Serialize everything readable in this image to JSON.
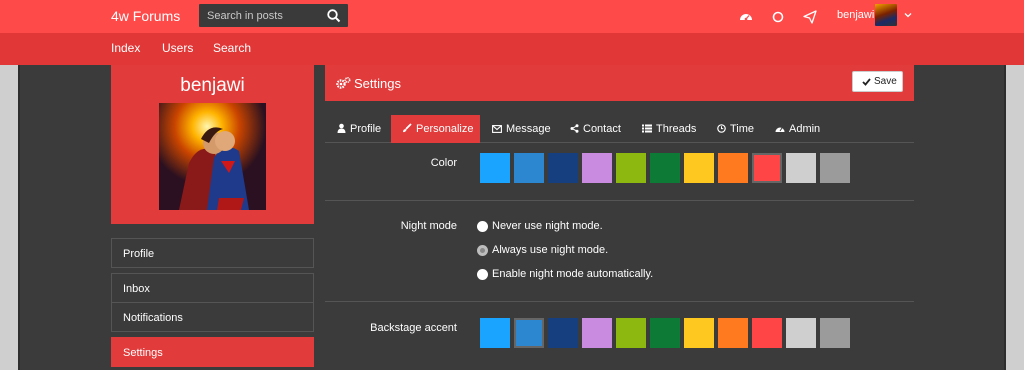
{
  "header": {
    "brand": "4w Forums",
    "search_placeholder": "Search in posts",
    "username": "benjawi"
  },
  "nav": {
    "items": [
      "Index",
      "Users",
      "Search"
    ]
  },
  "profile": {
    "name": "benjawi"
  },
  "sidebar": {
    "items": [
      "Profile",
      "Inbox",
      "Notifications",
      "Settings"
    ],
    "active": "Settings"
  },
  "settings": {
    "title": "Settings",
    "save_label": "Save",
    "tabs": [
      "Profile",
      "Personalize",
      "Message",
      "Contact",
      "Threads",
      "Time",
      "Admin"
    ],
    "active_tab": "Personalize",
    "color_label": "Color",
    "night_mode_label": "Night mode",
    "night_mode_options": [
      "Never use night mode.",
      "Always use night mode.",
      "Enable night mode automatically."
    ],
    "night_mode_selected": "Always use night mode.",
    "backstage_label": "Backstage accent",
    "color_swatches": [
      "#1aa3ff",
      "#2d86d0",
      "#153f7f",
      "#c88be0",
      "#8cb80f",
      "#0d7a35",
      "#ffc820",
      "#ff7a1f",
      "#ff4545",
      "#cfcfcf",
      "#9b9b9b"
    ],
    "color_selected_index": 8,
    "backstage_selected_index": 1
  },
  "colors": {
    "primary": "#ff4a4a",
    "primary_dark": "#e13b3b",
    "background": "#3b3b3b"
  }
}
